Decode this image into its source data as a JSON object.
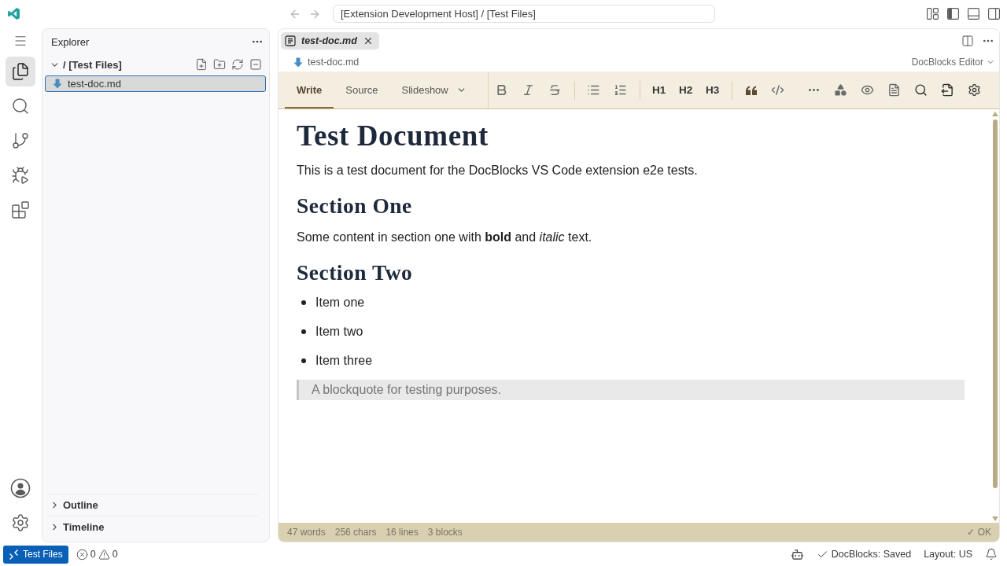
{
  "title_bar": {
    "command_center": "[Extension Development Host] / [Test Files]"
  },
  "activity_bar": {
    "items": [
      {
        "kind": "explorer",
        "selected": true
      },
      {
        "kind": "search",
        "selected": false
      },
      {
        "kind": "scm",
        "selected": false
      },
      {
        "kind": "debug",
        "selected": false
      },
      {
        "kind": "extensions",
        "selected": false
      }
    ],
    "bottom": [
      {
        "kind": "accounts"
      },
      {
        "kind": "manage"
      }
    ]
  },
  "sidebar": {
    "title": "Explorer",
    "folder": {
      "label": "/ [Test Files]",
      "expanded": true,
      "files": [
        {
          "name": "test-doc.md",
          "selected": true
        }
      ]
    },
    "sections": [
      {
        "label": "Outline",
        "expanded": false
      },
      {
        "label": "Timeline",
        "expanded": false
      }
    ]
  },
  "editor": {
    "tabs": [
      {
        "label": "test-doc.md",
        "selected": true,
        "preview": true
      }
    ],
    "breadcrumb": "test-doc.md",
    "editor_type": "DocBlocks Editor",
    "modes": [
      {
        "label": "Write",
        "selected": true,
        "dropdown": false
      },
      {
        "label": "Source",
        "selected": false,
        "dropdown": false
      },
      {
        "label": "Slideshow",
        "selected": false,
        "dropdown": true
      }
    ],
    "toolbar": [
      [
        {
          "kind": "bold"
        },
        {
          "kind": "italic"
        },
        {
          "kind": "strikethrough"
        }
      ],
      [
        {
          "kind": "bullet-list"
        },
        {
          "kind": "numbered-list"
        }
      ],
      [
        {
          "kind": "heading",
          "label": "H1"
        },
        {
          "kind": "heading",
          "label": "H2"
        },
        {
          "kind": "heading",
          "label": "H3"
        }
      ],
      [
        {
          "kind": "quote"
        },
        {
          "kind": "code"
        },
        {
          "kind": "more"
        },
        {
          "kind": "shapes"
        },
        {
          "kind": "preview"
        },
        {
          "kind": "document"
        },
        {
          "kind": "search"
        },
        {
          "kind": "export"
        },
        {
          "kind": "settings"
        }
      ]
    ],
    "document": [
      {
        "kind": "h1",
        "text": "Test Document"
      },
      {
        "kind": "paragraph",
        "text": "This is a test document for the DocBlocks VS Code extension e2e tests."
      },
      {
        "kind": "h2",
        "text": "Section One"
      },
      {
        "kind": "paragraph",
        "text": "Some content in section one with **bold** and *italic* text."
      },
      {
        "kind": "h2",
        "text": "Section Two"
      },
      {
        "kind": "list",
        "items": [
          "Item one",
          "Item two",
          "Item three"
        ]
      },
      {
        "kind": "blockquote",
        "text": "A blockquote for testing purposes."
      }
    ],
    "footer": {
      "stats": [
        "47 words",
        "256 chars",
        "16 lines",
        "3 blocks"
      ],
      "status": "✓ OK"
    }
  },
  "status_bar": {
    "remote": "Test Files",
    "errors": "0",
    "warnings": "0",
    "docblocks": "DocBlocks: Saved",
    "layout": "Layout: US"
  }
}
